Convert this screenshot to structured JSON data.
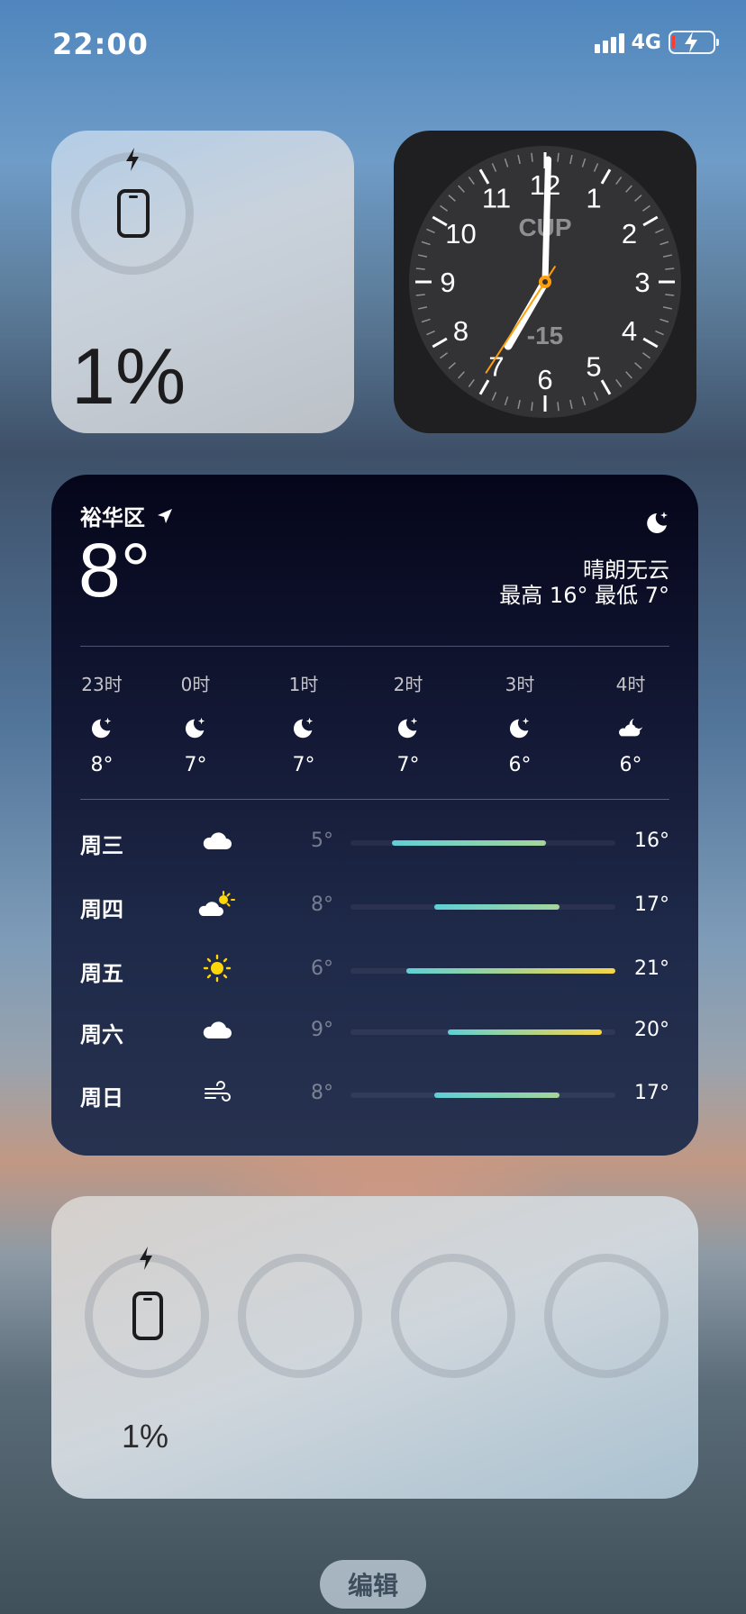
{
  "status_bar": {
    "time": "22:00",
    "network": "4G",
    "battery_level": 0.01,
    "charging": true,
    "icons": [
      "signal-icon",
      "battery-charging-icon"
    ]
  },
  "battery_widget_small": {
    "percent": "1%",
    "level": 0.01,
    "icons": [
      "bolt-icon",
      "iphone-icon"
    ]
  },
  "clock_widget": {
    "city_code": "CUP",
    "offset": "-15",
    "numerals": [
      "12",
      "1",
      "2",
      "3",
      "4",
      "5",
      "6",
      "7",
      "8",
      "9",
      "10",
      "11"
    ],
    "time": "19:00"
  },
  "weather": {
    "location": "裕华区",
    "temperature": "8°",
    "condition": "晴朗无云",
    "high_low": "最高 16° 最低 7°",
    "icon": "moon-stars-icon",
    "hourly": [
      {
        "time": "23时",
        "icon": "moon-stars-icon",
        "temp": "8°"
      },
      {
        "time": "0时",
        "icon": "moon-stars-icon",
        "temp": "7°"
      },
      {
        "time": "1时",
        "icon": "moon-stars-icon",
        "temp": "7°"
      },
      {
        "time": "2时",
        "icon": "moon-stars-icon",
        "temp": "7°"
      },
      {
        "time": "3时",
        "icon": "moon-stars-icon",
        "temp": "6°"
      },
      {
        "time": "4时",
        "icon": "cloud-moon-icon",
        "temp": "6°"
      }
    ],
    "daily": [
      {
        "day": "周三",
        "icon": "cloud-icon",
        "low": "5°",
        "high": "16°",
        "low_val": 5,
        "high_val": 16
      },
      {
        "day": "周四",
        "icon": "cloud-sun-icon",
        "low": "8°",
        "high": "17°",
        "low_val": 8,
        "high_val": 17
      },
      {
        "day": "周五",
        "icon": "sun-icon",
        "low": "6°",
        "high": "21°",
        "low_val": 6,
        "high_val": 21
      },
      {
        "day": "周六",
        "icon": "cloud-icon",
        "low": "9°",
        "high": "20°",
        "low_val": 9,
        "high_val": 20
      },
      {
        "day": "周日",
        "icon": "wind-icon",
        "low": "8°",
        "high": "17°",
        "low_val": 8,
        "high_val": 17
      }
    ],
    "range_min": 2,
    "range_max": 21
  },
  "battery_widget_large": {
    "percent": "1%",
    "level": 0.01,
    "icons": [
      "bolt-icon",
      "iphone-icon"
    ]
  },
  "edit_button": {
    "label": "编辑"
  }
}
